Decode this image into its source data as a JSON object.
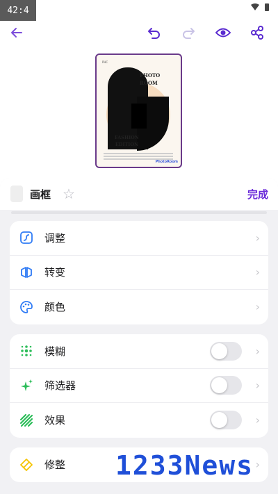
{
  "status": {
    "time": "42:4"
  },
  "toolbar": {
    "back": "arrow-left-icon",
    "undo": "undo-icon",
    "redo": "redo-icon",
    "preview": "eye-icon",
    "share": "share-icon"
  },
  "preview": {
    "top_small": "PHC",
    "title_line1": "PHOTO",
    "title_line2": "ROOM",
    "edition_line1": "FASHION",
    "edition_line2": "EDITION",
    "brand": "PhotoRoom"
  },
  "sheet": {
    "title": "画框",
    "done_label": "完成"
  },
  "group1": [
    {
      "label": "调整",
      "icon": "adjust-icon"
    },
    {
      "label": "转变",
      "icon": "transform-icon"
    },
    {
      "label": "颜色",
      "icon": "palette-icon"
    }
  ],
  "group2": [
    {
      "label": "模糊",
      "icon": "blur-icon",
      "enabled": false
    },
    {
      "label": "筛选器",
      "icon": "sparkle-icon",
      "enabled": false
    },
    {
      "label": "效果",
      "icon": "effects-icon",
      "enabled": false
    }
  ],
  "group3": [
    {
      "label": "修整",
      "icon": "retouch-icon"
    }
  ],
  "watermark": "1233News",
  "colors": {
    "accent": "#6a2bd9",
    "blue_icon": "#2f7bf5",
    "green_icon": "#2dbd5a",
    "yellow_icon": "#f5c400"
  }
}
